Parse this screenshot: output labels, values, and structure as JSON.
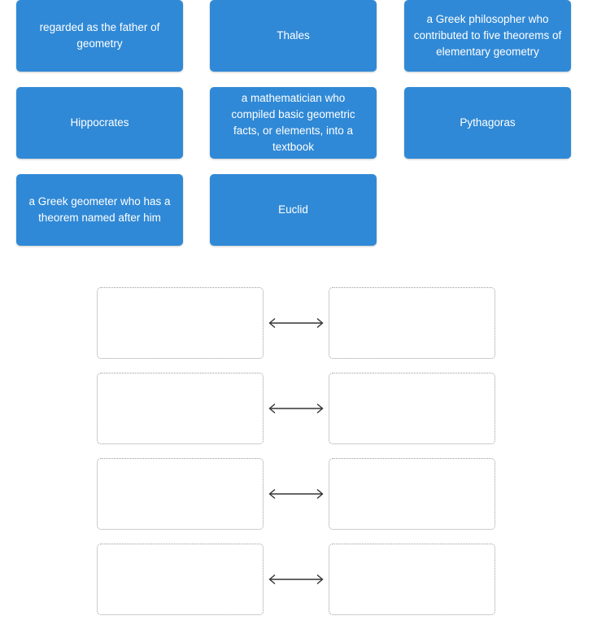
{
  "page": {
    "background_color": "#ffffff",
    "tile_color": "#3089d6",
    "tile_text_color": "#ffffff",
    "dropzone_border_color": "#9a9a9a",
    "arrow_color": "#333333"
  },
  "tile_bank": {
    "rows": [
      [
        {
          "label": "regarded as the father of geometry",
          "kind": "definition"
        },
        {
          "label": "Thales",
          "kind": "term"
        },
        {
          "label": "a Greek philosopher who contributed to five theorems of elementary geometry",
          "kind": "definition"
        }
      ],
      [
        {
          "label": "Hippocrates",
          "kind": "term"
        },
        {
          "label": "a mathematician who compiled basic geometric facts, or elements, into a textbook",
          "kind": "definition"
        },
        {
          "label": "Pythagoras",
          "kind": "term"
        }
      ],
      [
        {
          "label": "a Greek geometer who has a theorem named after him",
          "kind": "definition"
        },
        {
          "label": "Euclid",
          "kind": "term"
        },
        {
          "label": "",
          "kind": "spacer"
        }
      ]
    ]
  },
  "match_area": {
    "connector_icon": "double-headed-arrow-icon",
    "rows": [
      {
        "left_value": "",
        "right_value": ""
      },
      {
        "left_value": "",
        "right_value": ""
      },
      {
        "left_value": "",
        "right_value": ""
      },
      {
        "left_value": "",
        "right_value": ""
      }
    ]
  }
}
